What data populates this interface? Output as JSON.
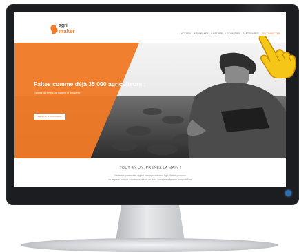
{
  "site": {
    "logo": {
      "line1": "agri",
      "line2": "maker"
    },
    "nav": [
      {
        "label": "ACCUEIL"
      },
      {
        "label": "AGRI MAKER"
      },
      {
        "label": "LA FERME"
      },
      {
        "label": "LES PARTIES"
      },
      {
        "label": "PARTENAIRES"
      },
      {
        "label": "SE CONNECTER"
      }
    ],
    "hero": {
      "title": "Faites comme déjà 35 000 agriculteurs :",
      "subtitle": "Gagnez du temps, de l'argent et des idées !",
      "button": "Rejoignez la communauté"
    },
    "section": {
      "title": "TOUT EN UN, PRENEZ LA MAIN !",
      "line1": "Véritable partenaire digital des agriculteurs, Agri Maker propose",
      "line2": "un espace unique où retrouver tout ce dont vous avez besoin au quotidien."
    }
  },
  "colors": {
    "brand": "#ef7a26",
    "monitor_bezel": "#1c1d20",
    "power_led": "#2f6fb0"
  },
  "icons": {
    "pointer": "pointing-hand-icon",
    "logo": "leaf-logo-icon"
  }
}
